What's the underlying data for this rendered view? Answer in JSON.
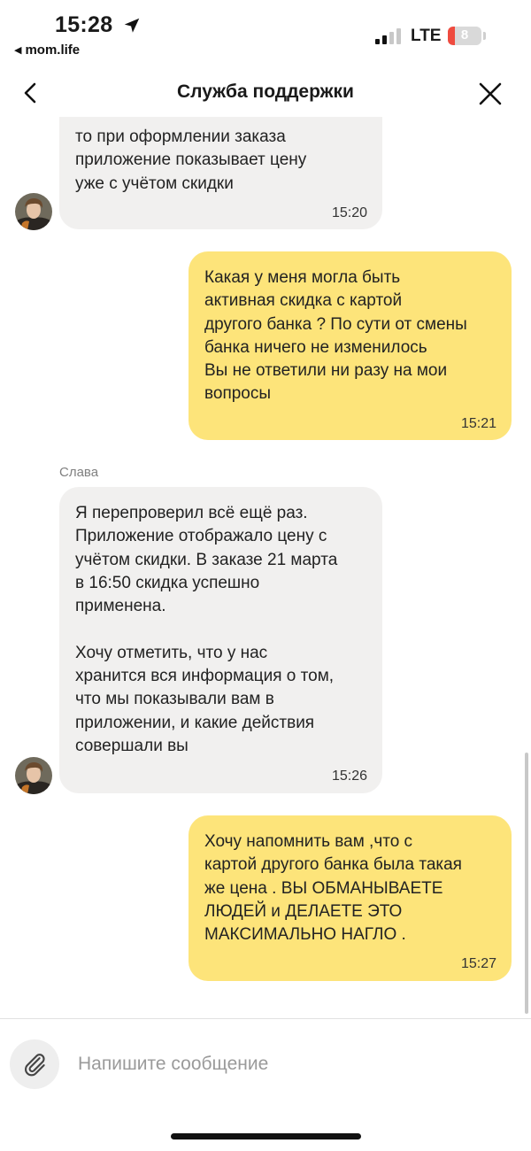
{
  "status_bar": {
    "time": "15:28",
    "back_app": "mom.life",
    "network": "LTE",
    "battery_level": "8",
    "icons": [
      "location-arrow-icon",
      "signal-icon",
      "battery-icon"
    ]
  },
  "header": {
    "title": "Служба поддержки",
    "back_icon": "chevron-left-icon",
    "close_icon": "close-icon"
  },
  "messages": [
    {
      "direction": "incoming",
      "text": "то при оформлении заказа\nприложение показывает цену\nуже с учётом скидки",
      "time": "15:20"
    },
    {
      "direction": "outgoing",
      "text": "Какая у меня могла быть\nактивная скидка с картой\nдругого банка ? По сути от смены\nбанка ничего не изменилось\nВы не ответили ни разу на мои\nвопросы",
      "time": "15:21"
    },
    {
      "direction": "incoming",
      "sender": "Слава",
      "text": "Я перепроверил всё ещё раз.\nПриложение отображало цену с\nучётом скидки. В заказе 21 марта\nв 16:50 скидка успешно\nприменена.\n\nХочу отметить, что у нас\nхранится вся информация о том,\nчто мы показывали вам в\nприложении, и какие действия\nсовершали вы",
      "time": "15:26"
    },
    {
      "direction": "outgoing",
      "text": "Хочу напомнить вам ,что с\nкартой другого банка была такая\nже цена . ВЫ ОБМАНЫВАЕТЕ\nЛЮДЕЙ и ДЕЛАЕТЕ ЭТО\nМАКСИМАЛЬНО НАГЛО .",
      "time": "15:27"
    }
  ],
  "composer": {
    "placeholder": "Напишите сообщение",
    "value": "",
    "attach_icon": "paperclip-icon"
  },
  "colors": {
    "incoming_bubble": "#f1f0ef",
    "outgoing_bubble": "#fde47a",
    "battery_low": "#ef4b3f"
  }
}
